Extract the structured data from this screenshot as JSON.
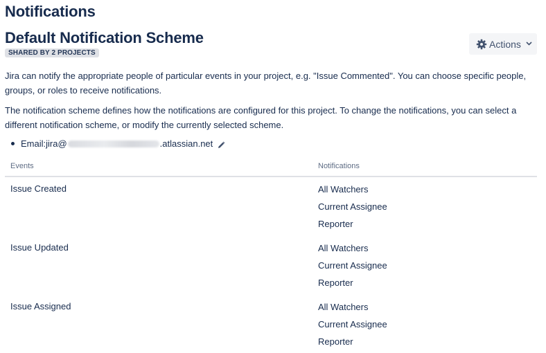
{
  "page": {
    "heading": "Notifications",
    "scheme_title": "Default Notification Scheme",
    "shared_badge": {
      "prefix": "SHARED BY ",
      "count": "2",
      "suffix": " PROJECTS"
    },
    "actions_label": "Actions"
  },
  "description": {
    "paragraph1": "Jira can notify the appropriate people of particular events in your project, e.g. \"Issue Commented\". You can choose specific people, groups, or roles to receive notifications.",
    "paragraph2": "The notification scheme defines how the notifications are configured for this project. To change the notifications, you can select a different notification scheme, or modify the currently selected scheme."
  },
  "email": {
    "label": "Email: ",
    "local_part": "jira@",
    "domain": ".atlassian.net"
  },
  "table": {
    "headers": {
      "events": "Events",
      "notifications": "Notifications"
    },
    "rows": [
      {
        "event": "Issue Created",
        "notifications": [
          "All Watchers",
          "Current Assignee",
          "Reporter"
        ]
      },
      {
        "event": "Issue Updated",
        "notifications": [
          "All Watchers",
          "Current Assignee",
          "Reporter"
        ]
      },
      {
        "event": "Issue Assigned",
        "notifications": [
          "All Watchers",
          "Current Assignee",
          "Reporter"
        ]
      }
    ]
  },
  "icons": {
    "actions": "gear-icon",
    "dropdown": "chevron-down-icon",
    "edit": "pencil-icon"
  }
}
